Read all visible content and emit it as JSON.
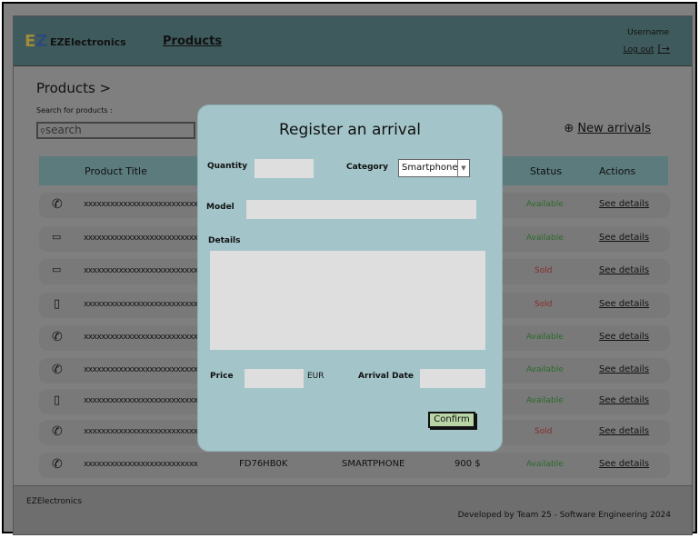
{
  "header": {
    "brand": "EZElectronics",
    "logo_letters": "EZ",
    "nav": "Products",
    "username": "Username",
    "logout": "Log out",
    "logout_icon": "logout-arrow-icon"
  },
  "main": {
    "breadcrumb": "Products >",
    "search_label": "Search for products :",
    "search_placeholder": "search",
    "new_arrivals": "New arrivals"
  },
  "table": {
    "headers": {
      "title": "Product Title",
      "status": "Status",
      "actions": "Actions"
    },
    "rows": [
      {
        "icon": "phone-icon",
        "title": "xxxxxxxxxxxxxxxxxxxxxxxxxx",
        "status": "Available",
        "action": "See details"
      },
      {
        "icon": "laptop-icon",
        "title": "xxxxxxxxxxxxxxxxxxxxxxxxxx",
        "status": "Available",
        "action": "See details"
      },
      {
        "icon": "laptop-icon",
        "title": "xxxxxxxxxxxxxxxxxxxxxxxxxx",
        "status": "Sold",
        "action": "See details"
      },
      {
        "icon": "appliance-icon",
        "title": "xxxxxxxxxxxxxxxxxxxxxxxxxx",
        "status": "Sold",
        "action": "See details"
      },
      {
        "icon": "phone-icon",
        "title": "xxxxxxxxxxxxxxxxxxxxxxxxxx",
        "status": "Available",
        "action": "See details"
      },
      {
        "icon": "phone-icon",
        "title": "xxxxxxxxxxxxxxxxxxxxxxxxxx",
        "status": "Available",
        "action": "See details"
      },
      {
        "icon": "appliance-icon",
        "title": "xxxxxxxxxxxxxxxxxxxxxxxxxx",
        "status": "Available",
        "action": "See details"
      },
      {
        "icon": "phone-icon",
        "title": "xxxxxxxxxxxxxxxxxxxxxxxxxx",
        "status": "Sold",
        "action": "See details"
      },
      {
        "icon": "phone-icon",
        "title": "xxxxxxxxxxxxxxxxxxxxxxxxxx",
        "code": "FD76HB0K",
        "category": "SMARTPHONE",
        "price": "900 $",
        "status": "Available",
        "action": "See details"
      }
    ]
  },
  "footer": {
    "left": "EZElectronics",
    "right": "Developed by Team 25 - Software Engineering 2024"
  },
  "modal": {
    "title": "Register an arrival",
    "quantity": "Quantity",
    "category": "Category",
    "category_value": "Smartphone",
    "model": "Model",
    "details": "Details",
    "price": "Price",
    "currency": "EUR",
    "arrival_date": "Arrival Date",
    "confirm": "Confirm"
  },
  "colors": {
    "header": "#3f5a5c",
    "modal": "#a3c4c9",
    "available": "#2b6a2b",
    "sold": "#8a2a2a",
    "confirm": "#b9d5a6"
  }
}
